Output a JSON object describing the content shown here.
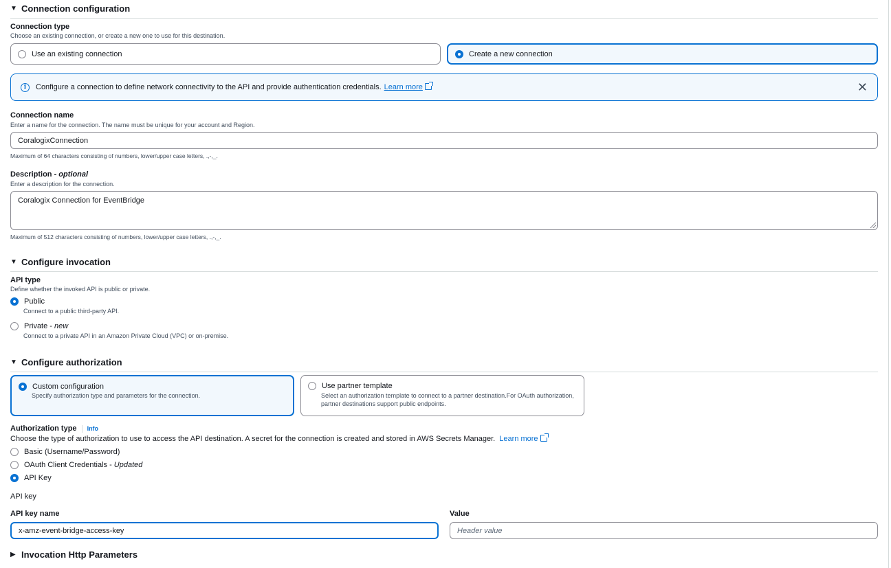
{
  "connection_config": {
    "title": "Connection configuration",
    "connection_type": {
      "label": "Connection type",
      "description": "Choose an existing connection, or create a new one to use for this destination.",
      "options": [
        {
          "label": "Use an existing connection",
          "selected": false
        },
        {
          "label": "Create a new connection",
          "selected": true
        }
      ]
    },
    "banner": {
      "text": "Configure a connection to define network connectivity to the API and provide authentication credentials.",
      "link": "Learn more"
    },
    "connection_name": {
      "label": "Connection name",
      "description": "Enter a name for the connection. The name must be unique for your account and Region.",
      "value": "CoralogixConnection",
      "hint": "Maximum of 64 characters consisting of numbers, lower/upper case letters, .,-,_."
    },
    "description": {
      "label": "Description - ",
      "label_optional": "optional",
      "description": "Enter a description for the connection.",
      "value": "Coralogix Connection for EventBridge",
      "hint": "Maximum of 512 characters consisting of numbers, lower/upper case letters, .,-,_."
    }
  },
  "invocation": {
    "title": "Configure invocation",
    "api_type": {
      "label": "API type",
      "description": "Define whether the invoked API is public or private.",
      "options": [
        {
          "label": "Public",
          "suffix": "",
          "description": "Connect to a public third-party API.",
          "selected": true
        },
        {
          "label": "Private - ",
          "suffix": "new",
          "description": "Connect to a private API in an Amazon Private Cloud (VPC) or on-premise.",
          "selected": false
        }
      ]
    }
  },
  "authorization": {
    "title": "Configure authorization",
    "tiles": [
      {
        "label": "Custom configuration",
        "description": "Specify authorization type and parameters for the connection.",
        "selected": true
      },
      {
        "label": "Use partner template",
        "description": "Select an authorization template to connect to a partner destination.For OAuth authorization, partner destinations support public endpoints.",
        "selected": false
      }
    ],
    "auth_type": {
      "label": "Authorization type",
      "info": "Info",
      "description": "Choose the type of authorization to use to access the API destination. A secret for the connection is created and stored in AWS Secrets Manager.",
      "link": "Learn more",
      "options": [
        {
          "label": "Basic (Username/Password)",
          "suffix": "",
          "selected": false
        },
        {
          "label": "OAuth Client Credentials - ",
          "suffix": "Updated",
          "selected": false
        },
        {
          "label": "API Key",
          "suffix": "",
          "selected": true
        }
      ]
    },
    "api_key": {
      "heading": "API key",
      "name_label": "API key name",
      "name_value": "x-amz-event-bridge-access-key",
      "value_label": "Value",
      "value_placeholder": "Header value"
    }
  },
  "http_params": {
    "title": "Invocation Http Parameters"
  },
  "colors": {
    "accent": "#0972d3",
    "banner_bg": "#f2f8fd",
    "border": "#8c8c94",
    "divider": "#d5dbdb"
  }
}
